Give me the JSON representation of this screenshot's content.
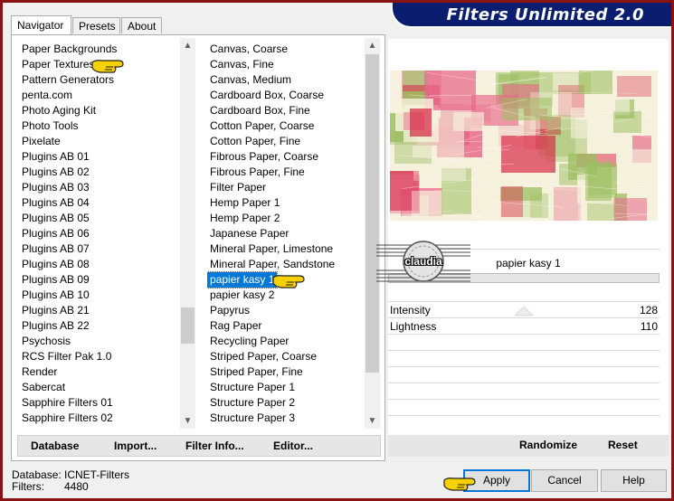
{
  "app": {
    "title": "Filters Unlimited 2.0",
    "frame_color": "#8a1212",
    "banner_color": "#0a1d6e",
    "selection_color": "#0078d7"
  },
  "tabs": [
    {
      "label": "Navigator",
      "active": true
    },
    {
      "label": "Presets",
      "active": false
    },
    {
      "label": "About",
      "active": false
    }
  ],
  "categories": [
    "Paper Backgrounds",
    "Paper Textures",
    "Pattern Generators",
    "penta.com",
    "Photo Aging Kit",
    "Photo Tools",
    "Pixelate",
    "Plugins AB 01",
    "Plugins AB 02",
    "Plugins AB 03",
    "Plugins AB 04",
    "Plugins AB 05",
    "Plugins AB 06",
    "Plugins AB 07",
    "Plugins AB 08",
    "Plugins AB 09",
    "Plugins AB 10",
    "Plugins AB 21",
    "Plugins AB 22",
    "Psychosis",
    "RCS Filter Pak 1.0",
    "Render",
    "Sabercat",
    "Sapphire Filters 01",
    "Sapphire Filters 02"
  ],
  "filters": [
    "Canvas, Coarse",
    "Canvas, Fine",
    "Canvas, Medium",
    "Cardboard Box, Coarse",
    "Cardboard Box, Fine",
    "Cotton Paper, Coarse",
    "Cotton Paper, Fine",
    "Fibrous Paper, Coarse",
    "Fibrous Paper, Fine",
    "Filter Paper",
    "Hemp Paper 1",
    "Hemp Paper 2",
    "Japanese Paper",
    "Mineral Paper, Limestone",
    "Mineral Paper, Sandstone",
    "papier kasy 1",
    "papier kasy 2",
    "Papyrus",
    "Rag Paper",
    "Recycling Paper",
    "Striped Paper, Coarse",
    "Striped Paper, Fine",
    "Structure Paper 1",
    "Structure Paper 2",
    "Structure Paper 3"
  ],
  "selected_filter": "papier kasy 1",
  "toolbar": {
    "database": "Database",
    "import": "Import...",
    "filter_info": "Filter Info...",
    "editor": "Editor..."
  },
  "preview": {
    "filter_name": "papier kasy 1",
    "watermark": "claudia",
    "colors": {
      "green": "#9cbf62",
      "pink": "#e8688a",
      "red": "#d9324e",
      "cream": "#f6f1dc"
    }
  },
  "params": [
    {
      "name": "Intensity",
      "value": "128"
    },
    {
      "name": "Lightness",
      "value": "110"
    }
  ],
  "right_buttons": {
    "randomize": "Randomize",
    "reset": "Reset"
  },
  "status": {
    "db_label": "Database:",
    "db_value": "ICNET-Filters",
    "filters_label": "Filters:",
    "filters_value": "4480"
  },
  "dialog_buttons": {
    "apply": "Apply",
    "cancel": "Cancel",
    "help": "Help"
  }
}
